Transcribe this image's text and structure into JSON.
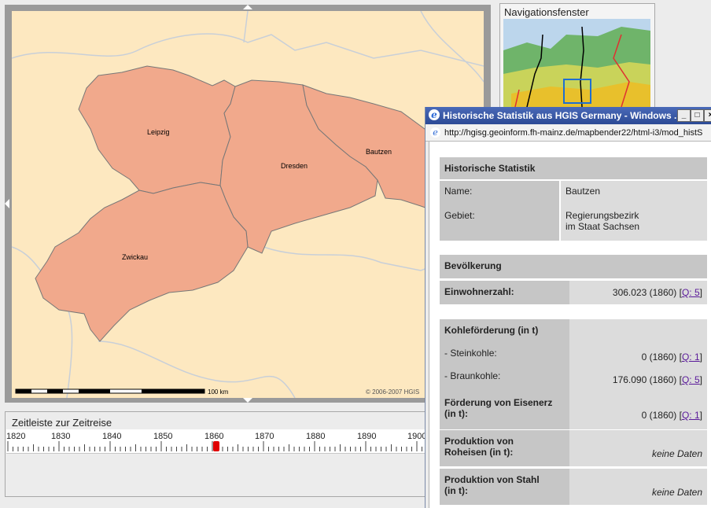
{
  "map": {
    "regions": [
      {
        "name": "Leipzig",
        "color": "#f1a98c"
      },
      {
        "name": "Dresden",
        "color": "#f1a98c"
      },
      {
        "name": "Bautzen",
        "color": "#f1a98c"
      },
      {
        "name": "Zwickau",
        "color": "#f1a98c"
      }
    ],
    "background_color": "#fde8c0",
    "scalebar_label": "100 km",
    "copyright": "© 2006-2007 HGIS"
  },
  "nav_window": {
    "title": "Navigationsfenster"
  },
  "timeline": {
    "title": "Zeitleiste zur Zeitreise",
    "years": [
      "1820",
      "1830",
      "1840",
      "1850",
      "1860",
      "1870",
      "1880",
      "1890",
      "1900"
    ],
    "selected_year": "1860"
  },
  "popup": {
    "title": "Historische Statistik aus HGIS Germany - Windows ...",
    "url": "http://hgisg.geoinform.fh-mainz.de/mapbender22/html-i3/mod_histS",
    "section_title": "Historische Statistik",
    "name_label": "Name:",
    "name_value": "Bautzen",
    "area_label": "Gebiet:",
    "area_value_line1": "Regierungsbezirk",
    "area_value_line2": "im Staat Sachsen",
    "population_header": "Bevölkerung",
    "population_label": "Einwohnerzahl:",
    "population_value": "306.023 (1860)",
    "population_source": "Q: 5",
    "coal_header": "Kohleförderung (in t)",
    "hard_coal_label": "- Steinkohle:",
    "hard_coal_value": "0 (1860)",
    "hard_coal_source": "Q: 1",
    "brown_coal_label": "- Braunkohle:",
    "brown_coal_value": "176.090 (1860)",
    "brown_coal_source": "Q: 5",
    "iron_ore_label_1": "Förderung von Eisenerz",
    "iron_ore_label_2": "(in t):",
    "iron_ore_value": "0 (1860)",
    "iron_ore_source": "Q: 1",
    "pig_iron_label_1": "Produktion von",
    "pig_iron_label_2": "Roheisen (in t):",
    "pig_iron_value": "keine Daten",
    "steel_label_1": "Produktion von Stahl",
    "steel_label_2": "(in t):",
    "steel_value": "keine Daten"
  }
}
